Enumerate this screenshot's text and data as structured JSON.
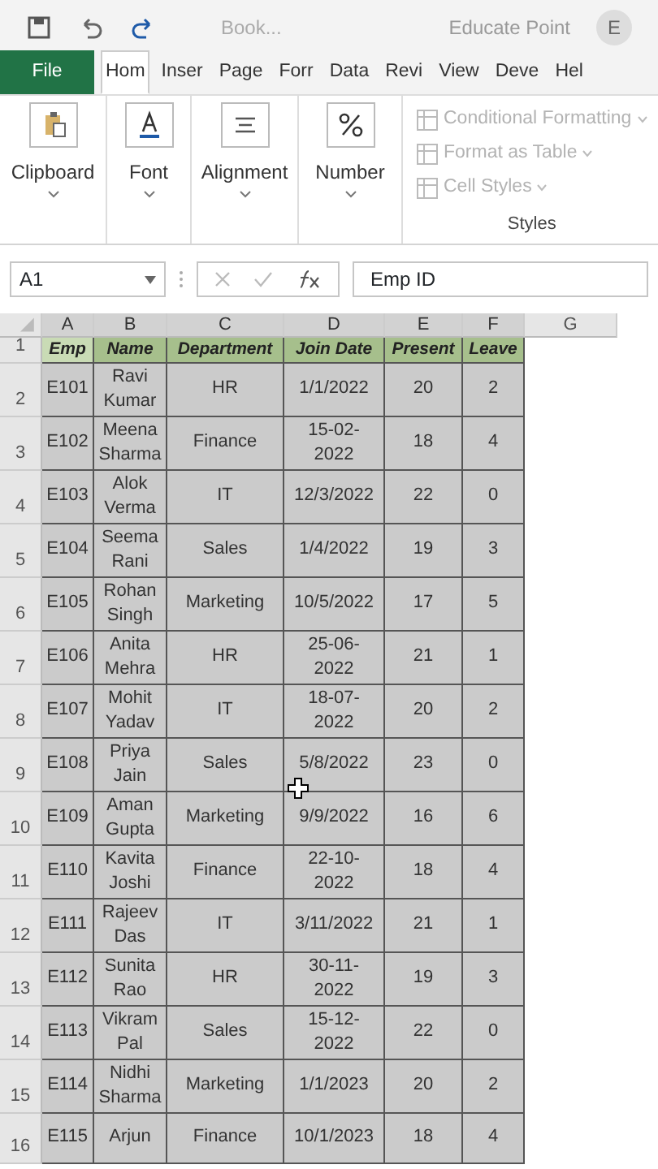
{
  "title_bar": {
    "document": "Book...",
    "user": "Educate Point",
    "avatar": "E"
  },
  "tabs": [
    {
      "label": "File",
      "kind": "file",
      "selected": false
    },
    {
      "label": "Hom",
      "kind": "tab",
      "selected": true
    },
    {
      "label": "Inser",
      "kind": "tab",
      "selected": false
    },
    {
      "label": "Page",
      "kind": "tab",
      "selected": false
    },
    {
      "label": "Forr",
      "kind": "tab",
      "selected": false
    },
    {
      "label": "Data",
      "kind": "tab",
      "selected": false
    },
    {
      "label": "Revi",
      "kind": "tab",
      "selected": false
    },
    {
      "label": "View",
      "kind": "tab",
      "selected": false
    },
    {
      "label": "Deve",
      "kind": "tab",
      "selected": false
    },
    {
      "label": "Hel",
      "kind": "tab",
      "selected": false
    }
  ],
  "ribbon_groups": [
    {
      "label": "Clipboard"
    },
    {
      "label": "Font"
    },
    {
      "label": "Alignment"
    },
    {
      "label": "Number"
    }
  ],
  "styles_group": {
    "label": "Styles",
    "items": [
      {
        "label": "Conditional Formatting",
        "disabled": true
      },
      {
        "label": "Format as Table",
        "disabled": true
      },
      {
        "label": "Cell Styles",
        "disabled": true
      }
    ]
  },
  "formula_bar": {
    "name_box": "A1",
    "formula": "Emp ID"
  },
  "sheet": {
    "columns": [
      "A",
      "B",
      "C",
      "D",
      "E",
      "F",
      "G"
    ],
    "header_row": {
      "number": "1",
      "cells": [
        "Emp",
        "Name",
        "Department",
        "Join Date",
        "Present",
        "Leave"
      ]
    },
    "rows": [
      {
        "number": "2",
        "cells": [
          "E101",
          "Ravi Kumar",
          "HR",
          "1/1/2022",
          "20",
          "2"
        ]
      },
      {
        "number": "3",
        "cells": [
          "E102",
          "Meena Sharma",
          "Finance",
          "15-02-2022",
          "18",
          "4"
        ]
      },
      {
        "number": "4",
        "cells": [
          "E103",
          "Alok Verma",
          "IT",
          "12/3/2022",
          "22",
          "0"
        ]
      },
      {
        "number": "5",
        "cells": [
          "E104",
          "Seema Rani",
          "Sales",
          "1/4/2022",
          "19",
          "3"
        ]
      },
      {
        "number": "6",
        "cells": [
          "E105",
          "Rohan Singh",
          "Marketing",
          "10/5/2022",
          "17",
          "5"
        ]
      },
      {
        "number": "7",
        "cells": [
          "E106",
          "Anita Mehra",
          "HR",
          "25-06-2022",
          "21",
          "1"
        ]
      },
      {
        "number": "8",
        "cells": [
          "E107",
          "Mohit Yadav",
          "IT",
          "18-07-2022",
          "20",
          "2"
        ]
      },
      {
        "number": "9",
        "cells": [
          "E108",
          "Priya Jain",
          "Sales",
          "5/8/2022",
          "23",
          "0"
        ]
      },
      {
        "number": "10",
        "cells": [
          "E109",
          "Aman Gupta",
          "Marketing",
          "9/9/2022",
          "16",
          "6"
        ]
      },
      {
        "number": "11",
        "cells": [
          "E110",
          "Kavita Joshi",
          "Finance",
          "22-10-2022",
          "18",
          "4"
        ]
      },
      {
        "number": "12",
        "cells": [
          "E111",
          "Rajeev Das",
          "IT",
          "3/11/2022",
          "21",
          "1"
        ]
      },
      {
        "number": "13",
        "cells": [
          "E112",
          "Sunita Rao",
          "HR",
          "30-11-2022",
          "19",
          "3"
        ]
      },
      {
        "number": "14",
        "cells": [
          "E113",
          "Vikram Pal",
          "Sales",
          "15-12-2022",
          "22",
          "0"
        ]
      },
      {
        "number": "15",
        "cells": [
          "E114",
          "Nidhi Sharma",
          "Marketing",
          "1/1/2023",
          "20",
          "2"
        ]
      },
      {
        "number": "16",
        "cells": [
          "E115",
          "Arjun",
          "Finance",
          "10/1/2023",
          "18",
          "4"
        ]
      }
    ]
  }
}
